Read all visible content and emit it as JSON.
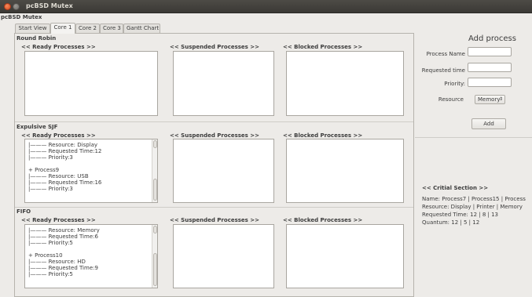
{
  "window": {
    "title": "pcBSD Mutex",
    "app_label": "pcBSD Mutex"
  },
  "tabs": [
    "Start View",
    "Core 1",
    "Core 2",
    "Core 3",
    "Gantt Chart"
  ],
  "active_tab": "Core 1",
  "sections": [
    {
      "title": "Round Robin",
      "ready_header": "<< Ready Processes >>",
      "suspended_header": "<< Suspended Processes >>",
      "blocked_header": "<< Blocked Processes >>",
      "ready_items": []
    },
    {
      "title": "Expulsive SJF",
      "ready_header": "<< Ready Processes >>",
      "suspended_header": "<< Suspended Processes >>",
      "blocked_header": "<< Blocked Processes >>",
      "ready_items": [
        "|——— Resource: Display",
        "|——— Requested Time:12",
        "|——— Priority:3",
        "",
        "+ Process9",
        "|——— Resource: USB",
        "|——— Requested Time:16",
        "|——— Priority:3"
      ]
    },
    {
      "title": "FIFO",
      "ready_header": "<< Ready Processes >>",
      "suspended_header": "<< Suspended Processes >>",
      "blocked_header": "<< Blocked Processes >>",
      "ready_items": [
        "|——— Resource: Memory",
        "|——— Requested Time:6",
        "|——— Priority:5",
        "",
        "+ Process10",
        "|——— Resource: HD",
        "|——— Requested Time:9",
        "|——— Priority:5"
      ]
    }
  ],
  "add_process": {
    "title": "Add process",
    "name_label": "Process Name",
    "name_value": "",
    "time_label": "Requested time",
    "time_value": "",
    "priority_label": "Priority:",
    "priority_value": "",
    "resource_label": "Resource",
    "resource_selected": "Memory",
    "add_label": "Add"
  },
  "critical_section": {
    "title": "<< Critial Section >>",
    "lines": [
      "Name: Process7 | Process15 | Process",
      "Resource: Display | Printer | Memory",
      "Requested Time: 12 | 8 | 13",
      "Quantum: 12 | 5 | 12"
    ]
  }
}
